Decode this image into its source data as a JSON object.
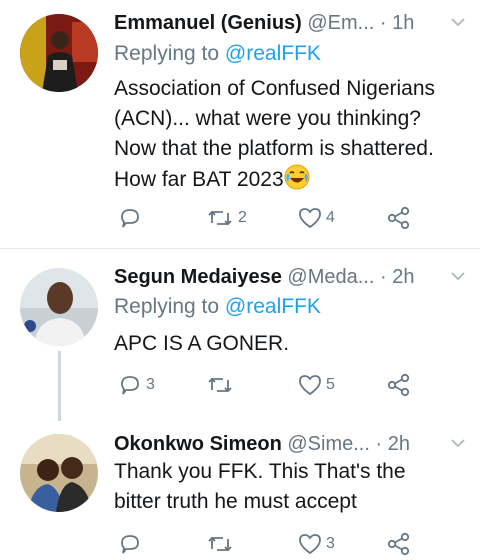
{
  "tweets": [
    {
      "name": "Emmanuel (Genius)",
      "handle": "@Em...",
      "dot": "·",
      "time": "1h",
      "replying_prefix": "Replying to",
      "replying_to": "@realFFK",
      "body_lines": [
        "Association of Confused Nigerians",
        "(ACN)... what were you thinking?",
        "Now that the platform is shattered.",
        "How far BAT 2023"
      ],
      "emoji": "face-with-tears-of-joy",
      "replies": "",
      "retweets": "2",
      "likes": "4"
    },
    {
      "name": "Segun Medaiyese",
      "handle": "@Meda...",
      "dot": "·",
      "time": "2h",
      "replying_prefix": "Replying to",
      "replying_to": "@realFFK",
      "body_lines": [
        "APC IS A GONER."
      ],
      "replies": "3",
      "retweets": "",
      "likes": "5"
    },
    {
      "name": "Okonkwo Simeon",
      "handle": "@Sime...",
      "dot": "·",
      "time": "2h",
      "body_lines": [
        "Thank you FFK. This That's the",
        "bitter truth he must accept"
      ],
      "replies": "",
      "retweets": "",
      "likes": "3"
    }
  ],
  "colors": {
    "text": "#14171a",
    "secondary": "#657786",
    "link": "#1da1f2",
    "divider": "#e1e8ed"
  },
  "icons": [
    "reply-icon",
    "retweet-icon",
    "like-icon",
    "share-icon",
    "chevron-down-icon"
  ]
}
